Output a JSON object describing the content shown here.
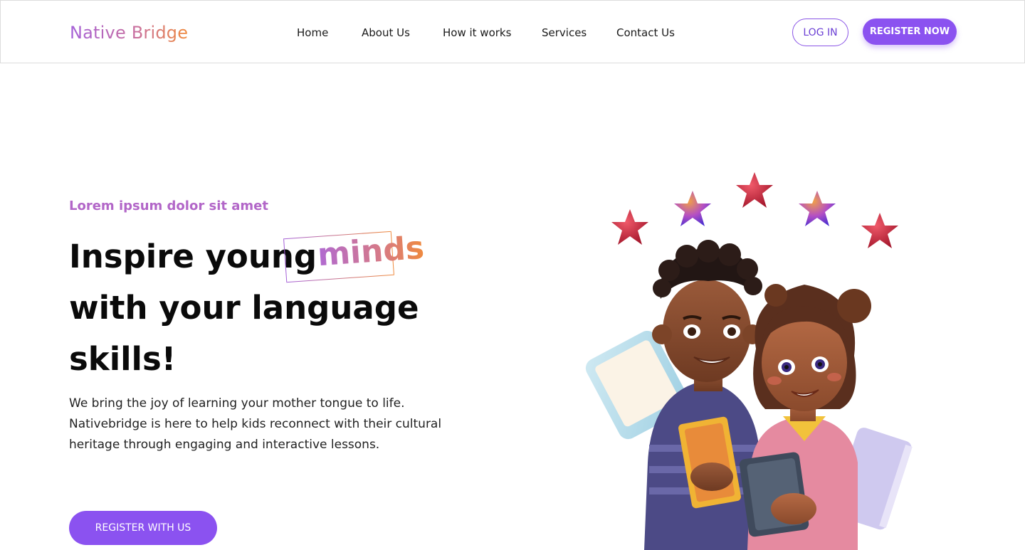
{
  "brand": {
    "name": "Native Bridge"
  },
  "nav": {
    "items": [
      {
        "label": "Home"
      },
      {
        "label": "About Us"
      },
      {
        "label": "How it works"
      },
      {
        "label": "Services"
      },
      {
        "label": "Contact Us"
      }
    ]
  },
  "auth": {
    "login_label": "LOG IN",
    "register_label": "REGISTER NOW"
  },
  "hero": {
    "eyebrow": "Lorem ipsum dolor sit amet",
    "headline_line1": "Inspire young",
    "highlight_word": "minds",
    "headline_line2": "with your language",
    "headline_line3": "skills!",
    "description": "We bring the joy of learning your mother tongue to life. Nativebridge is here to help kids reconnect with their cultural heritage through engaging and interactive lessons.",
    "cta_label": "REGISTER WITH US"
  },
  "colors": {
    "accent": "#8b52f0",
    "brand_gradient_start": "#a460d8",
    "brand_gradient_end": "#ef8a3d",
    "eyebrow": "#b266c8"
  },
  "illustration": {
    "icons": [
      "star-icon",
      "tablet-icon",
      "book-icon",
      "children-illustration"
    ]
  }
}
